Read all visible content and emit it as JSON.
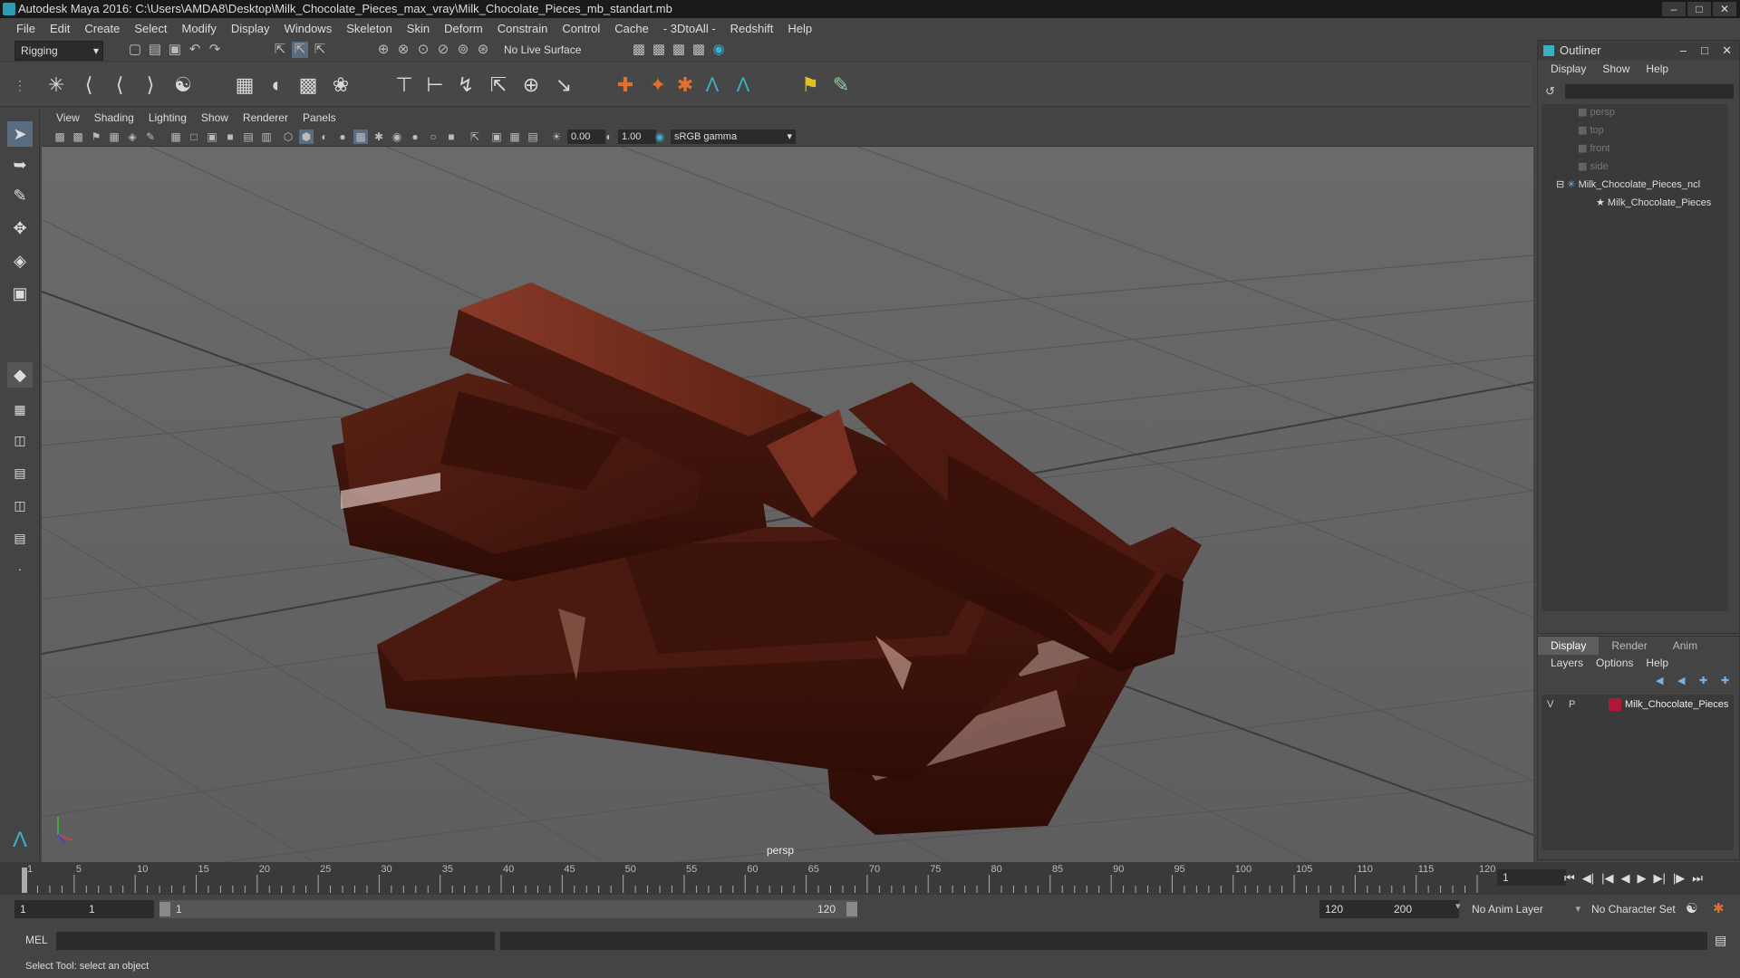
{
  "window": {
    "title": "Autodesk Maya 2016: C:\\Users\\AMDA8\\Desktop\\Milk_Chocolate_Pieces_max_vray\\Milk_Chocolate_Pieces_mb_standart.mb"
  },
  "menubar": [
    "File",
    "Edit",
    "Create",
    "Select",
    "Modify",
    "Display",
    "Windows",
    "Skeleton",
    "Skin",
    "Deform",
    "Constrain",
    "Control",
    "Cache",
    "- 3DtoAll -",
    "Redshift",
    "Help"
  ],
  "toolbar": {
    "mode": "Rigging",
    "live_surface": "No Live Surface"
  },
  "panel": {
    "menu": [
      "View",
      "Shading",
      "Lighting",
      "Show",
      "Renderer",
      "Panels"
    ],
    "exposure": "0.00",
    "gamma": "1.00",
    "color_space": "sRGB gamma",
    "camera_label": "persp"
  },
  "outliner": {
    "title": "Outliner",
    "menu": [
      "Display",
      "Show",
      "Help"
    ],
    "items": [
      "persp",
      "top",
      "front",
      "side",
      "Milk_Chocolate_Pieces_ncl",
      "Milk_Chocolate_Pieces"
    ]
  },
  "layers": {
    "tabs": [
      "Display",
      "Render",
      "Anim"
    ],
    "menu": [
      "Layers",
      "Options",
      "Help"
    ],
    "row": {
      "v": "V",
      "p": "P",
      "name": "Milk_Chocolate_Pieces",
      "color": "#b0183a"
    }
  },
  "timeline": {
    "ticks": [
      "1",
      "5",
      "10",
      "15",
      "20",
      "25",
      "30",
      "35",
      "40",
      "45",
      "50",
      "55",
      "60",
      "65",
      "70",
      "75",
      "80",
      "85",
      "90",
      "95",
      "100",
      "105",
      "110",
      "115",
      "120"
    ],
    "current_frame": "1"
  },
  "range": {
    "start": "1",
    "start_inner": "1",
    "slider_start": "1",
    "slider_end": "120",
    "end_inner": "120",
    "end": "200",
    "anim_layer": "No Anim Layer",
    "character_set": "No Character Set"
  },
  "command": {
    "mel_label": "MEL"
  },
  "status": {
    "text": "Select Tool: select an object"
  },
  "colors": {
    "chocolate": "#4a1a10",
    "chocolate_highlight": "#9a4a35",
    "viewport_bg": "#666666",
    "grid": "#555555"
  }
}
